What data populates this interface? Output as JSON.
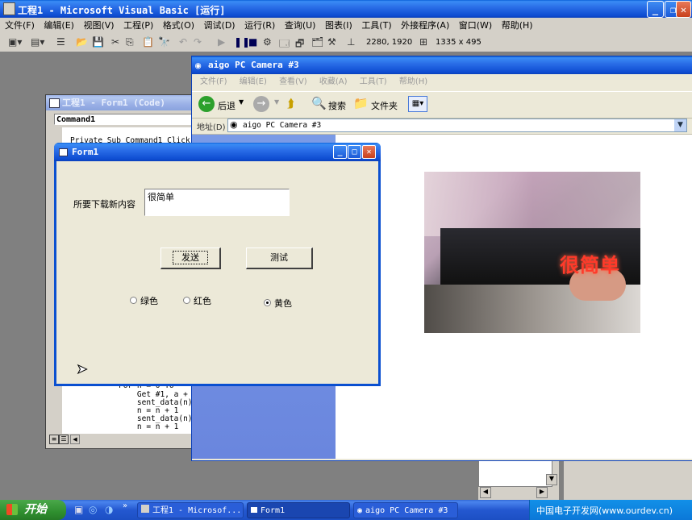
{
  "vb": {
    "title": "工程1 - Microsoft Visual Basic [运行]",
    "menu": [
      "文件(F)",
      "编辑(E)",
      "视图(V)",
      "工程(P)",
      "格式(O)",
      "调试(D)",
      "运行(R)",
      "查询(U)",
      "图表(I)",
      "工具(T)",
      "外接程序(A)",
      "窗口(W)",
      "帮助(H)"
    ],
    "toolbar_coords": "2280, 1920",
    "toolbar_size": "1335 x 495"
  },
  "code_window": {
    "title": "工程1 - Form1 (Code)",
    "object_combo": "Command1",
    "lines_top": [
      "Private Sub Command1_Click()"
    ],
    "lines_bottom": [
      "For n = 0 To",
      "    Get #1, a + k,",
      "    sent_data(n) =",
      "    n = n + 1",
      "    sent_data(n) =",
      "    n = n + 1"
    ]
  },
  "camera_window": {
    "title": "aigo PC Camera #3",
    "menu": [
      "文件(F)",
      "编辑(E)",
      "查看(V)",
      "收藏(A)",
      "工具(T)",
      "帮助(H)"
    ],
    "back_label": "后退",
    "search_label": "搜索",
    "folders_label": "文件夹",
    "address_label": "地址(D)",
    "address_value": "aigo PC Camera #3",
    "preview_overlay_text": "很简单"
  },
  "form1": {
    "title": "Form1",
    "content_label": "所要下载新内容",
    "content_value": "很简单",
    "send_button": "发送",
    "test_button": "测试",
    "radio_green": "绿色",
    "radio_red": "红色",
    "radio_yellow": "黄色",
    "selected_radio": "黄色"
  },
  "taskbar": {
    "start_label": "开始",
    "tasks": [
      "工程1 - Microsof...",
      "Form1",
      "aigo PC Camera #3"
    ],
    "watermark": "中国电子开发网(www.ourdev.cn)"
  },
  "colors": {
    "xp_blue": "#0a4fd0",
    "taskbar_blue": "#1f56d4",
    "start_green": "#3a9a3a",
    "form_bg": "#ece9d8"
  }
}
